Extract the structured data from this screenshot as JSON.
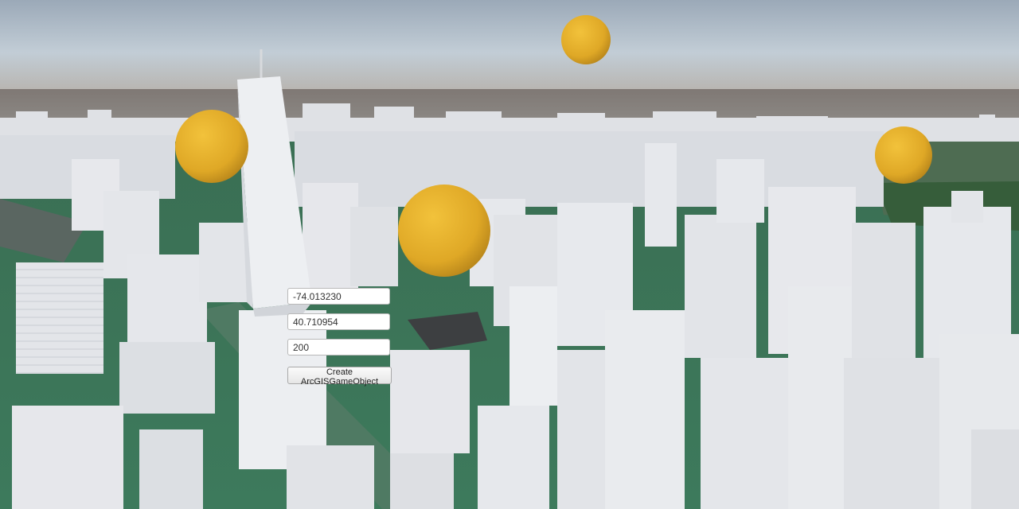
{
  "ui": {
    "longitude_value": "-74.013230",
    "latitude_value": "40.710954",
    "altitude_value": "200",
    "create_button_label": "Create ArcGISGameObject"
  },
  "scene": {
    "spheres": 4,
    "colors": {
      "sky_top": "#b4c4d3",
      "haze": "#8e8a89",
      "ground_green": "#2f8a5e",
      "building": "#e4e6ea",
      "sphere": "#e6b02a"
    }
  }
}
